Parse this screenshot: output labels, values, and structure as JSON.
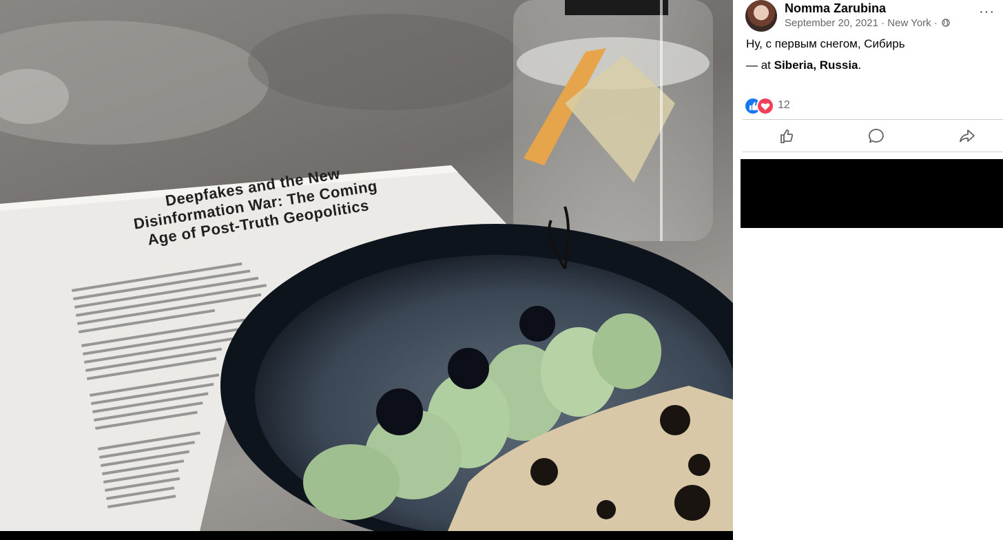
{
  "photo": {
    "paper_title_lines": [
      "Deepfakes and the New",
      "Disinformation War: The Coming",
      "Age of Post-Truth Geopolitics"
    ]
  },
  "post": {
    "author": "Nomma Zarubina",
    "date": "September 20, 2021",
    "separator": " · ",
    "location": "New York",
    "privacy_icon": "globe-icon",
    "more_icon": "more-options-icon",
    "more_label": "···",
    "text": "Ну, с первым снегом, Сибирь",
    "checkin_prefix": "— at ",
    "checkin_place": "Siberia, Russia",
    "checkin_suffix": "."
  },
  "reactions": {
    "icons": [
      "like-icon",
      "love-icon"
    ],
    "count": "12"
  },
  "actions": [
    {
      "name": "like-button",
      "icon": "thumbs-up-icon"
    },
    {
      "name": "comment-button",
      "icon": "comment-bubble-icon"
    },
    {
      "name": "share-button",
      "icon": "share-arrow-icon"
    }
  ],
  "colors": {
    "like_blue": "#1877f2",
    "love_red": "#f33e58",
    "meta_gray": "#65676b",
    "text_black": "#050505"
  }
}
